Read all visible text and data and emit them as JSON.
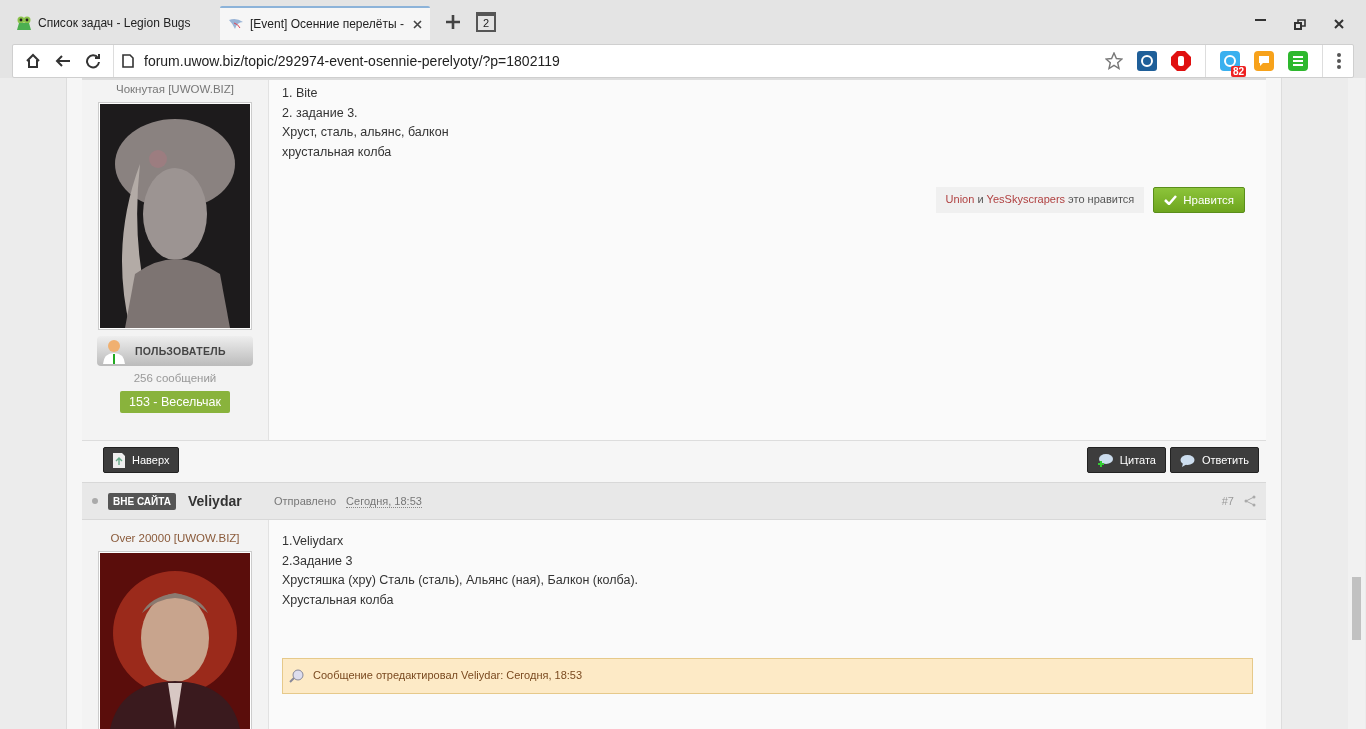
{
  "browser": {
    "tabs": [
      {
        "title": "Список задач - Legion Bugs",
        "selected": false
      },
      {
        "title": "[Event] Осенние перелёты -",
        "selected": true
      }
    ],
    "tab_count": "2",
    "url": "forum.uwow.biz/topic/292974-event-osennie-perelyoty/?p=1802119",
    "extension_badge": "82"
  },
  "posts": [
    {
      "author_title": "Чокнутая [UWOW.BIZ]",
      "rank_label": "ПОЛЬЗОВАТЕЛЬ",
      "post_count": "256 сообщений",
      "reputation": "153 - Весельчак",
      "body": [
        "1. Bite",
        "2. задание 3.",
        "Хруст, сталь, альянс, балкон",
        "хрустальная колба"
      ],
      "likes": {
        "users": [
          "Union",
          "YesSkyscrapers"
        ],
        "joiner": "и",
        "suffix": "это нравится"
      },
      "like_button": "Нравится",
      "footer_left": [
        "Наверх"
      ],
      "footer_right": [
        "Цитата",
        "Ответить"
      ]
    },
    {
      "online": false,
      "status": "ВНЕ САЙТА",
      "author": "Veliydar",
      "posted_label": "Отправлено",
      "posted_time": "Сегодня, 18:53",
      "number": "#7",
      "author_title": "Over 20000 [UWOW.BIZ]",
      "body": [
        "1.Veliydarx",
        "2.Задание 3",
        "Хрустяшка (хру) Сталь (сталь), Альянс (ная), Балкон (колба).",
        "Хрустальная колба"
      ],
      "edit_note": "Сообщение отредактировал Veliydar: Сегодня, 18:53"
    }
  ]
}
